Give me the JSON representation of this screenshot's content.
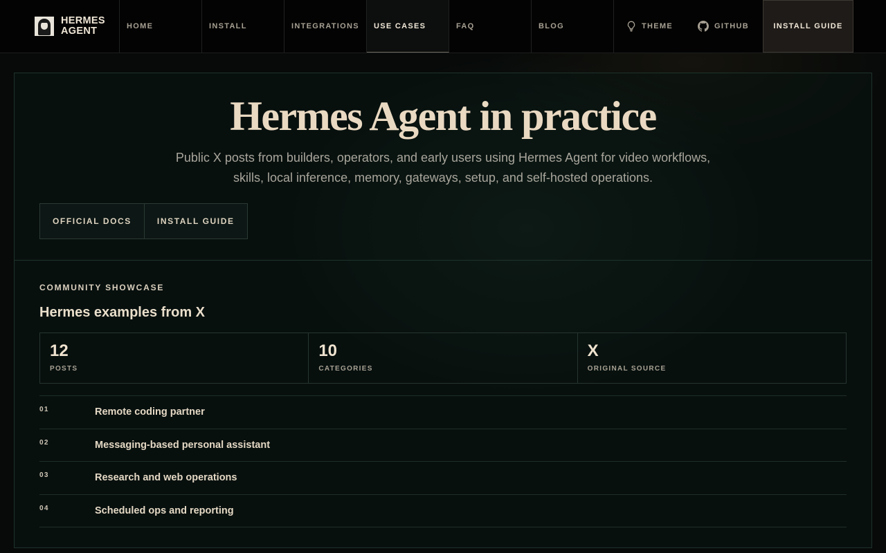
{
  "brand": {
    "line1": "HERMES",
    "line2": "AGENT"
  },
  "nav": {
    "items": [
      {
        "label": "HOME",
        "active": false
      },
      {
        "label": "INSTALL",
        "active": false
      },
      {
        "label": "INTEGRATIONS",
        "active": false
      },
      {
        "label": "USE CASES",
        "active": true
      },
      {
        "label": "FAQ",
        "active": false
      },
      {
        "label": "BLOG",
        "active": false
      }
    ],
    "theme_label": "THEME",
    "github_label": "GITHUB",
    "cta_label": "INSTALL GUIDE"
  },
  "hero": {
    "title": "Hermes Agent in practice",
    "subtitle": "Public X posts from builders, operators, and early users using Hermes Agent for video workflows, skills, local inference, memory, gateways, setup, and self-hosted operations.",
    "buttons": [
      "OFFICIAL DOCS",
      "INSTALL GUIDE"
    ]
  },
  "showcase": {
    "eyebrow": "COMMUNITY SHOWCASE",
    "title": "Hermes examples from X",
    "stats": [
      {
        "value": "12",
        "label": "POSTS"
      },
      {
        "value": "10",
        "label": "CATEGORIES"
      },
      {
        "value": "X",
        "label": "ORIGINAL SOURCE"
      }
    ],
    "rows": [
      {
        "index": "01",
        "title": "Remote coding partner"
      },
      {
        "index": "02",
        "title": "Messaging-based personal assistant"
      },
      {
        "index": "03",
        "title": "Research and web operations"
      },
      {
        "index": "04",
        "title": "Scheduled ops and reporting"
      }
    ]
  },
  "icons": {
    "theme": "lightbulb-icon",
    "github": "github-icon",
    "logo": "hermes-logo"
  }
}
